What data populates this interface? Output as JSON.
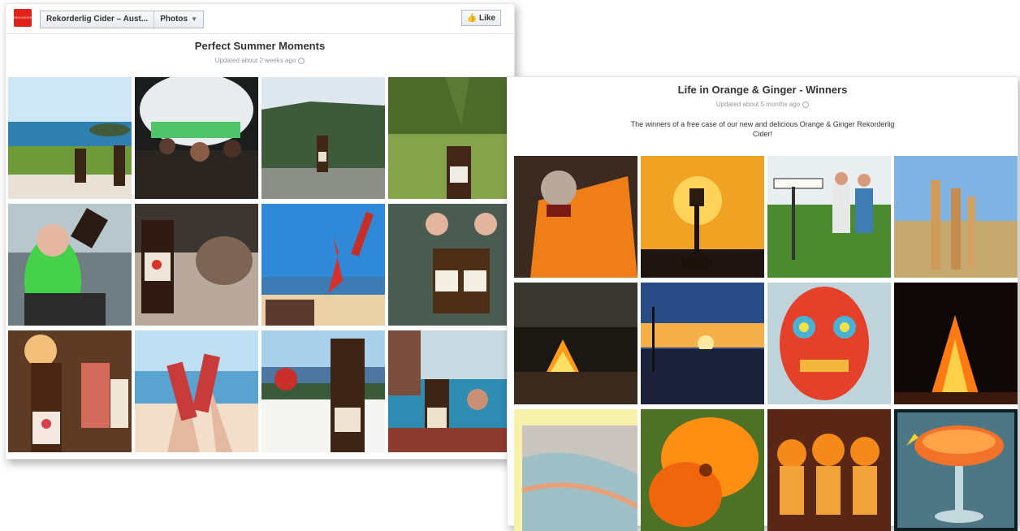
{
  "left_panel": {
    "logo_text": "REKORDERLIG",
    "breadcrumb": {
      "page": "Rekorderlig Cider – Aust...",
      "section": "Photos"
    },
    "like_label": "Like",
    "album": {
      "title": "Perfect Summer Moments",
      "updated": "Updated about 2 weeks ago"
    },
    "photos": [
      {
        "subject": "coastal picnic with cider bottles"
      },
      {
        "subject": "crowd at night under dome tent"
      },
      {
        "subject": "cider bottle on railing, valley view"
      },
      {
        "subject": "cider bottle in grass"
      },
      {
        "subject": "girl with green hair drinking"
      },
      {
        "subject": "cider bottle and cat"
      },
      {
        "subject": "beach jump with red dress"
      },
      {
        "subject": "hands holding two cider bottles"
      },
      {
        "subject": "cider bottle at bar"
      },
      {
        "subject": "cider glasses toast at beach"
      },
      {
        "subject": "cider on balcony with ocean view"
      },
      {
        "subject": "cider bottle by pool"
      }
    ]
  },
  "right_panel": {
    "album": {
      "title": "Life in Orange & Ginger - Winners",
      "updated": "Updated about 5 months ago",
      "description": "The winners of a free case of our new and delicious Orange & Ginger Rekorderlig Cider!"
    },
    "photos": [
      {
        "subject": "zombie in orange jacket"
      },
      {
        "subject": "lamp post at sunset"
      },
      {
        "subject": "family by street sign"
      },
      {
        "subject": "giraffes in field"
      },
      {
        "subject": "campfire at dusk"
      },
      {
        "subject": "sunset over water"
      },
      {
        "subject": "colorful mask sculpture"
      },
      {
        "subject": "bonfire at night"
      },
      {
        "subject": "hazy sky"
      },
      {
        "subject": "orange flower close-up"
      },
      {
        "subject": "people in orange hats"
      },
      {
        "subject": "orange cocktail"
      }
    ]
  },
  "colors": {
    "brand_red": "#e2231a",
    "title_text": "#333333",
    "meta_text": "#9197a3"
  }
}
